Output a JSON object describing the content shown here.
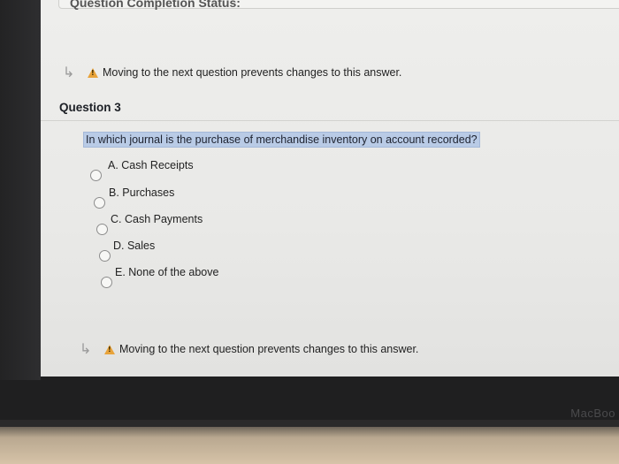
{
  "previous_card": {
    "cut_title": "Question Completion Status:"
  },
  "warnings": {
    "top": "Moving to the next question prevents changes to this answer.",
    "bottom": "Moving to the next question prevents changes to this answer."
  },
  "question": {
    "heading": "Question 3",
    "text": "In which journal is the purchase of merchandise inventory on account recorded?",
    "options": [
      {
        "label": "A. Cash Receipts"
      },
      {
        "label": "B. Purchases"
      },
      {
        "label": "C. Cash Payments"
      },
      {
        "label": "D. Sales"
      },
      {
        "label": "E. None of the above"
      }
    ],
    "selected": null
  },
  "device": {
    "label": "MacBoo"
  },
  "colors": {
    "highlight": "#b9cbe6",
    "warning_icon": "#e8a33a",
    "heading_text": "#1d2026"
  },
  "icons": {
    "warning": "warning-triangle-icon",
    "arrow": "return-arrow-icon",
    "radio": "radio-unselected-icon"
  }
}
